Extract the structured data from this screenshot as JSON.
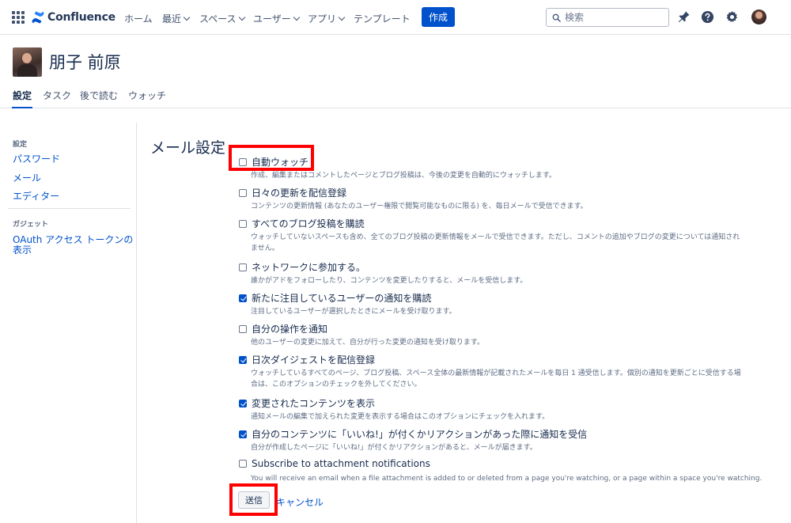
{
  "topnav": {
    "product_name": "Confluence",
    "items": [
      {
        "label": "ホーム",
        "has_dropdown": false
      },
      {
        "label": "最近",
        "has_dropdown": true
      },
      {
        "label": "スペース",
        "has_dropdown": true
      },
      {
        "label": "ユーザー",
        "has_dropdown": true
      },
      {
        "label": "アプリ",
        "has_dropdown": true
      },
      {
        "label": "テンプレート",
        "has_dropdown": false
      }
    ],
    "create_label": "作成",
    "search_placeholder": "検索",
    "icons": [
      "app-switcher-icon",
      "notifications-icon",
      "help-icon",
      "settings-icon",
      "user-avatar"
    ],
    "accent_color": "#0052cc"
  },
  "profile": {
    "name": "朋子 前原"
  },
  "tabs": [
    {
      "label": "設定",
      "active": true
    },
    {
      "label": "タスク",
      "active": false
    },
    {
      "label": "後で読む",
      "active": false
    },
    {
      "label": "ウォッチ",
      "active": false
    }
  ],
  "sidebar": {
    "settings_heading": "設定",
    "settings_links": [
      "パスワード",
      "メール",
      "エディター"
    ],
    "gadgets_heading": "ガジェット",
    "gadget_link_line1": "OAuth アクセス トークンの",
    "gadget_link_line2": "表示"
  },
  "main": {
    "title": "メール設定",
    "options": [
      {
        "label": "自動ウォッチ",
        "checked": false,
        "desc": [
          "作成、編集またはコメントしたページとブログ投稿は、今後の変更を自動的にウォッチします。"
        ]
      },
      {
        "label": "日々の更新を配信登録",
        "checked": false,
        "desc": [
          "コンテンツの更新情報 (あなたのユーザー権限で閲覧可能なものに限る) を、毎日メールで受信できます。"
        ]
      },
      {
        "label": "すべてのブログ投稿を購読",
        "checked": false,
        "desc": [
          "ウォッチしていないスペースも含め、全てのブログ投稿の更新情報をメールで受信できます。ただし、コメントの追加やブログの変更については通知され",
          "ません。"
        ]
      },
      {
        "label": "ネットワークに参加する。",
        "checked": false,
        "desc": [
          "誰かがアドをフォローしたり、コンテンツを変更したりすると、メールを受信します。"
        ]
      },
      {
        "label": "新たに注目しているユーザーの通知を購読",
        "checked": true,
        "desc": [
          "注目しているユーザーが選択したときにメールを受け取ります。"
        ]
      },
      {
        "label": "自分の操作を通知",
        "checked": false,
        "desc": [
          "他のユーザーの変更に加えて、自分が行った変更の通知を受け取ります。"
        ]
      },
      {
        "label": "日次ダイジェストを配信登録",
        "checked": true,
        "desc": [
          "ウォッチしているすべてのページ、ブログ投稿、スペース全体の最新情報が記載されたメールを毎日 1 通受信します。個別の通知を更新ごとに受信する場",
          "合は、このオプションのチェックを外してください。"
        ]
      },
      {
        "label": "変更されたコンテンツを表示",
        "checked": true,
        "desc": [
          "通知メールの編集で加えられた変更を表示する場合はこのオプションにチェックを入れます。"
        ]
      },
      {
        "label": "自分のコンテンツに「いいね!」が付くかリアクションがあった際に通知を受信",
        "checked": true,
        "desc": [
          "自分が作成したページに「いいね!」が付くかリアクションがあると、メールが届きます。"
        ]
      },
      {
        "label": "Subscribe to attachment notifications",
        "checked": false,
        "desc": [
          "You will receive an email when a file attachment is added to or deleted from a page you're watching, or a page within a space you're watching."
        ]
      }
    ],
    "submit_label": "送信",
    "cancel_label": "キャンセル"
  },
  "annotations": {
    "highlight_color": "#ff0000"
  }
}
